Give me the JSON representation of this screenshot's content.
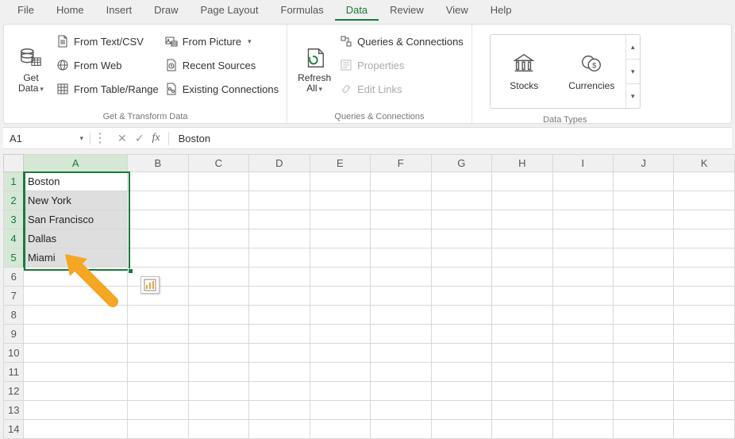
{
  "tabs": [
    "File",
    "Home",
    "Insert",
    "Draw",
    "Page Layout",
    "Formulas",
    "Data",
    "Review",
    "View",
    "Help"
  ],
  "active_tab": "Data",
  "ribbon": {
    "get_transform": {
      "title": "Get & Transform Data",
      "get_data": "Get Data",
      "from_text_csv": "From Text/CSV",
      "from_web": "From Web",
      "from_table_range": "From Table/Range",
      "from_picture": "From Picture",
      "recent_sources": "Recent Sources",
      "existing_connections": "Existing Connections"
    },
    "queries": {
      "title": "Queries & Connections",
      "refresh_all": "Refresh All",
      "queries_connections": "Queries & Connections",
      "properties": "Properties",
      "edit_links": "Edit Links"
    },
    "data_types": {
      "title": "Data Types",
      "stocks": "Stocks",
      "currencies": "Currencies"
    }
  },
  "namebox": "A1",
  "formula": "Boston",
  "columns": [
    "A",
    "B",
    "C",
    "D",
    "E",
    "F",
    "G",
    "H",
    "I",
    "J",
    "K"
  ],
  "rows": [
    "1",
    "2",
    "3",
    "4",
    "5",
    "6",
    "7",
    "8",
    "9",
    "10",
    "11",
    "12",
    "13",
    "14"
  ],
  "cells": {
    "A1": "Boston",
    "A2": "New York",
    "A3": "San Francisco",
    "A4": "Dallas",
    "A5": "Miami"
  },
  "selection": {
    "col": "A",
    "rows": [
      1,
      2,
      3,
      4,
      5
    ],
    "active": "A1"
  }
}
